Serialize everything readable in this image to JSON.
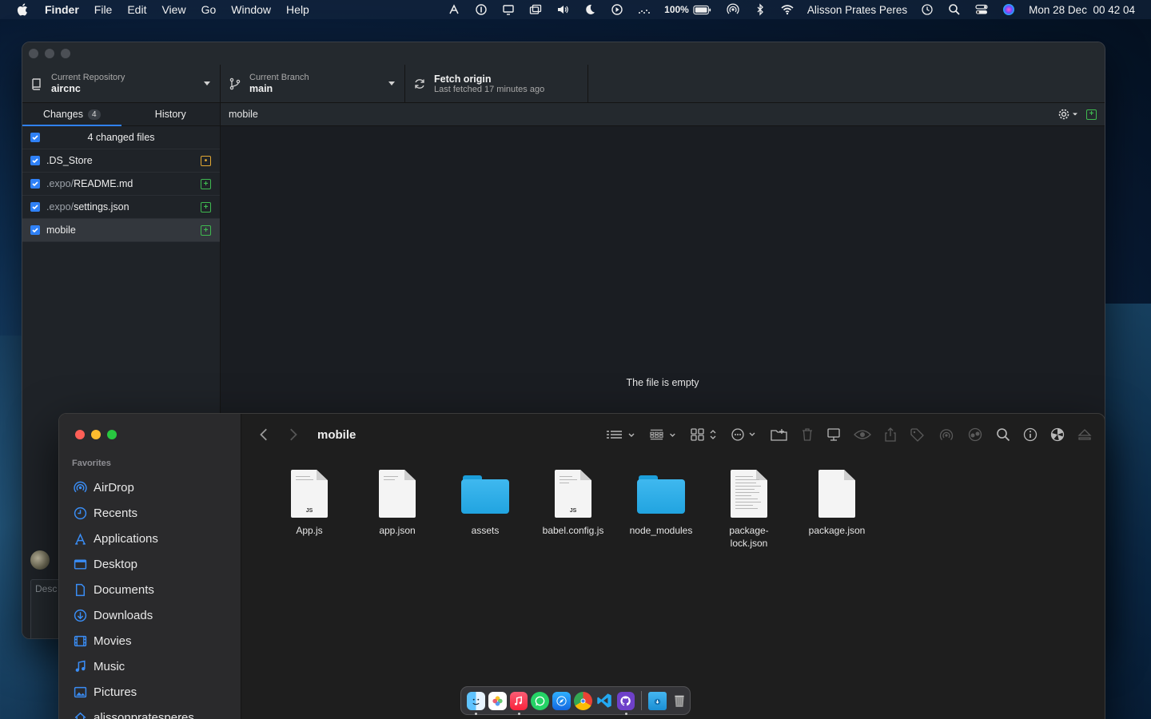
{
  "menubar": {
    "app_name": "Finder",
    "menus": [
      "File",
      "Edit",
      "View",
      "Go",
      "Window",
      "Help"
    ],
    "battery": "100%",
    "user": "Alisson Prates Peres",
    "datetime": "Mon 28 Dec  00 42 04"
  },
  "github": {
    "repo_label": "Current Repository",
    "repo_name": "aircnc",
    "branch_label": "Current Branch",
    "branch_name": "main",
    "fetch_title": "Fetch origin",
    "fetch_sub": "Last fetched 17 minutes ago",
    "tabs": {
      "changes": "Changes",
      "changes_count": "4",
      "history": "History"
    },
    "changed_header": "4 changed files",
    "files": [
      {
        "dir": "",
        "name": ".DS_Store",
        "status": "modified"
      },
      {
        "dir": ".expo/",
        "name": "README.md",
        "status": "added"
      },
      {
        "dir": ".expo/",
        "name": "settings.json",
        "status": "added"
      },
      {
        "dir": "",
        "name": "mobile",
        "status": "added"
      }
    ],
    "selected_path": "mobile",
    "empty_message": "The file is empty",
    "commit_desc_placeholder": "Desc"
  },
  "finder": {
    "title": "mobile",
    "favorites_title": "Favorites",
    "favorites": [
      "AirDrop",
      "Recents",
      "Applications",
      "Desktop",
      "Documents",
      "Downloads",
      "Movies",
      "Music",
      "Pictures",
      "alissonpratesperes"
    ],
    "files": [
      {
        "name": "App.js",
        "kind": "js"
      },
      {
        "name": "app.json",
        "kind": "doc"
      },
      {
        "name": "assets",
        "kind": "folder"
      },
      {
        "name": "babel.config.js",
        "kind": "js"
      },
      {
        "name": "node_modules",
        "kind": "folder"
      },
      {
        "name": "package-lock.json",
        "kind": "text"
      },
      {
        "name": "package.json",
        "kind": "doc"
      }
    ],
    "js_label": "JS"
  },
  "colors": {
    "accent_blue": "#2f81f7",
    "added_green": "#3fb950",
    "modified_yellow": "#e2a833",
    "folder_blue": "#3fb8ef"
  },
  "dock": {
    "apps": [
      "finder-icon",
      "photos-icon",
      "music-icon",
      "whatsapp-icon",
      "safari-icon",
      "chrome-icon",
      "vscode-icon",
      "github-desktop-icon",
      "downloads-folder-icon",
      "trash-icon"
    ]
  }
}
